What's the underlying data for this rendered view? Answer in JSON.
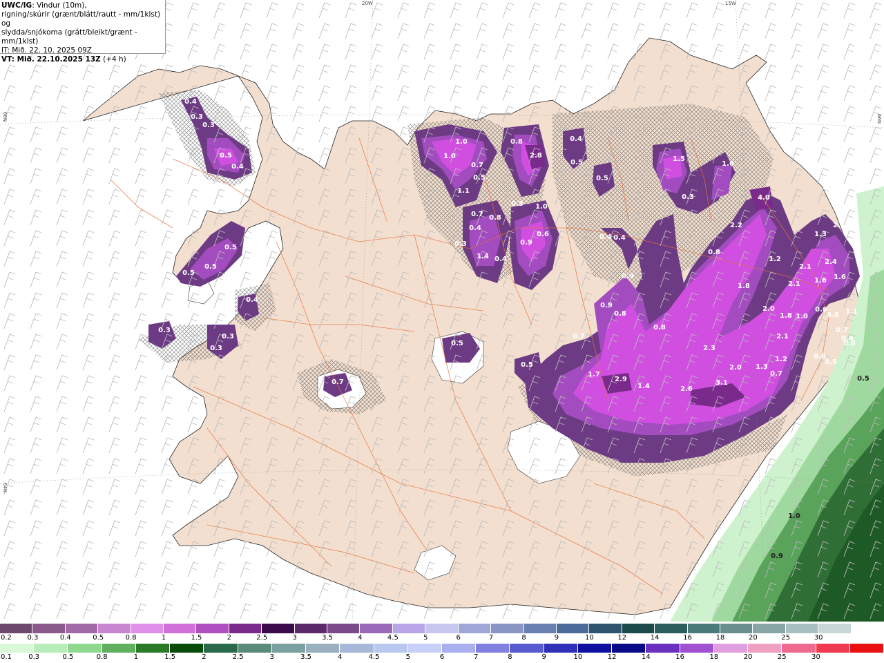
{
  "header": {
    "title_bold": "UWC/IG",
    "title_rest": ": Vindur (10m),",
    "line2": "rigning/skúrir (grænt/blátt/rautt - mm/1klst) og",
    "line3": "slydda/snjókoma (grátt/bleikt/grænt - mm/1klst)",
    "line4": "IT: Mið. 22. 10. 2025 09Z",
    "line5_bold": "VT: Mið. 22.10.2025 13Z",
    "line5_rest": " (+4 h)"
  },
  "graticule": {
    "lon_20w": "20W",
    "lon_15w": "15W",
    "lat_66n_left": "66N",
    "lat_66n_right": "66N",
    "lat_64n_left": "64N"
  },
  "colors": {
    "land": "#f3dfcf",
    "sea": "#ffffff",
    "roads": "#e8703a",
    "snow_core": "#d04fe0",
    "snow_mid": "#a34cc0",
    "snow_edge": "#6d3a84",
    "rain_light": "#cdf2cd",
    "rain_dark": "#1e5a26"
  },
  "precip_labels": [
    {
      "text": "0.4"
    },
    {
      "text": "0.3"
    },
    {
      "text": "0.3"
    },
    {
      "text": "0.5"
    },
    {
      "text": "0.4"
    },
    {
      "text": "0.5"
    },
    {
      "text": "0.5"
    },
    {
      "text": "0.5"
    },
    {
      "text": "0.4"
    },
    {
      "text": "0.3"
    },
    {
      "text": "0.3"
    },
    {
      "text": "0.3"
    },
    {
      "text": "0.7"
    },
    {
      "text": "0.5"
    },
    {
      "text": "1.0"
    },
    {
      "text": "1.0"
    },
    {
      "text": "0.7"
    },
    {
      "text": "0.5"
    },
    {
      "text": "1.1"
    },
    {
      "text": "0.8"
    },
    {
      "text": "2.8"
    },
    {
      "text": "0.4"
    },
    {
      "text": "0.5"
    },
    {
      "text": "0.5"
    },
    {
      "text": "0.7"
    },
    {
      "text": "0.8"
    },
    {
      "text": "0.4"
    },
    {
      "text": "0.3"
    },
    {
      "text": "1.4"
    },
    {
      "text": "0.4"
    },
    {
      "text": "0.3"
    },
    {
      "text": "1.0"
    },
    {
      "text": "0.6"
    },
    {
      "text": "0.9"
    },
    {
      "text": "1.5"
    },
    {
      "text": "1.6"
    },
    {
      "text": "0.3"
    },
    {
      "text": "0.4"
    },
    {
      "text": "0.4"
    },
    {
      "text": "0.9"
    },
    {
      "text": "0.9"
    },
    {
      "text": "0.8"
    },
    {
      "text": "0.7"
    },
    {
      "text": "0.8"
    },
    {
      "text": "4.0"
    },
    {
      "text": "2.2"
    },
    {
      "text": "0.8"
    },
    {
      "text": "1.8"
    },
    {
      "text": "2.1"
    },
    {
      "text": "1.3"
    },
    {
      "text": "1.2"
    },
    {
      "text": "2.1"
    },
    {
      "text": "2.4"
    },
    {
      "text": "2.1"
    },
    {
      "text": "1.6"
    },
    {
      "text": "1.6"
    },
    {
      "text": "2.0"
    },
    {
      "text": "1.8"
    },
    {
      "text": "1.0"
    },
    {
      "text": "0.6"
    },
    {
      "text": "0.8"
    },
    {
      "text": "1.1"
    },
    {
      "text": "0.7"
    },
    {
      "text": "0.6"
    },
    {
      "text": "2.1"
    },
    {
      "text": "2.3"
    },
    {
      "text": "2.0"
    },
    {
      "text": "1.3"
    },
    {
      "text": "1.2"
    },
    {
      "text": "0.7"
    },
    {
      "text": "0.8"
    },
    {
      "text": "0.5"
    },
    {
      "text": "0.5"
    },
    {
      "text": "1.7"
    },
    {
      "text": "2.9"
    },
    {
      "text": "1.4"
    },
    {
      "text": "2.6"
    },
    {
      "text": "3.1"
    },
    {
      "text": "0.8"
    }
  ],
  "rain_labels": [
    {
      "text": "0.5"
    },
    {
      "text": "1.0"
    },
    {
      "text": "0.9"
    }
  ],
  "legend_snow": {
    "ticks": [
      "0.2",
      "0.3",
      "0.4",
      "0.5",
      "0.8",
      "1",
      "1.5",
      "2",
      "2.5",
      "3",
      "3.5",
      "4",
      "4.5",
      "5",
      "6",
      "7",
      "8",
      "9",
      "10",
      "12",
      "14",
      "16",
      "18",
      "20",
      "25",
      "30"
    ],
    "colors": [
      "#6d4a6d",
      "#8a5a8a",
      "#a36aa8",
      "#c886d0",
      "#e090e8",
      "#d070d8",
      "#b050c0",
      "#7a2a8a",
      "#3a0a4a",
      "#5c2a6a",
      "#7a4a8a",
      "#9a6ab8",
      "#b8a6e8",
      "#c6c6ee",
      "#a0a6d6",
      "#8a96c4",
      "#6a80b0",
      "#4c6a9a",
      "#2e5470",
      "#1a4a4a",
      "#2c5e5e",
      "#4a7a7a",
      "#6a8e8e",
      "#88a6a6",
      "#a8c0c0",
      "#c8d8d8",
      "#ffffff"
    ]
  },
  "legend_rain": {
    "ticks": [
      "0.1",
      "0.3",
      "0.5",
      "0.8",
      "1",
      "1.5",
      "2",
      "2.5",
      "3",
      "3.5",
      "4",
      "4.5",
      "5",
      "6",
      "7",
      "8",
      "9",
      "10",
      "12",
      "14",
      "16",
      "18",
      "20",
      "25",
      "30"
    ],
    "colors": [
      "#d8f8d8",
      "#b8ecb8",
      "#90d890",
      "#60b060",
      "#2a7a2a",
      "#0a4a0a",
      "#2a6a4a",
      "#5a8a7a",
      "#7aa0a0",
      "#9ab0c0",
      "#a8b8d8",
      "#b8c8ee",
      "#c8d0f8",
      "#a8b0f0",
      "#8080e0",
      "#5a5ad0",
      "#3030b8",
      "#1010a0",
      "#0a0a88",
      "#6a30c0",
      "#a050d0",
      "#e0a0e0",
      "#f0a0c0",
      "#f06a90",
      "#f03a50",
      "#e81010"
    ]
  }
}
